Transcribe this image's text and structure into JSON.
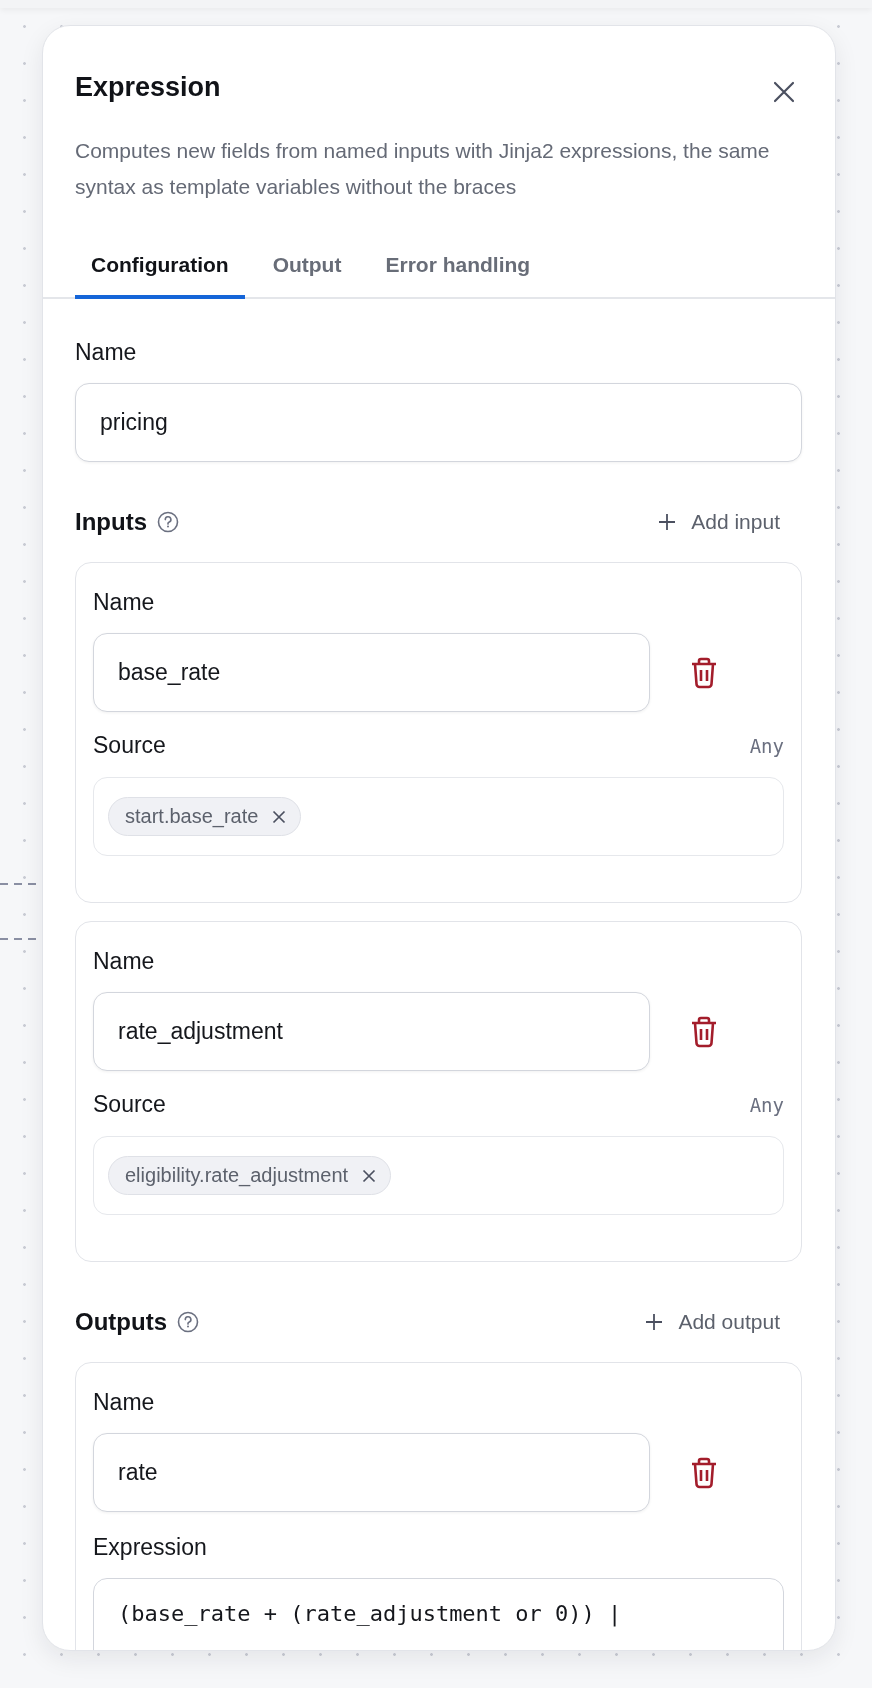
{
  "panel": {
    "title": "Expression",
    "description": "Computes new fields from named inputs with Jinja2 expressions, the same syntax as template variables without the braces"
  },
  "tabs": [
    {
      "label": "Configuration",
      "selected": true
    },
    {
      "label": "Output",
      "selected": false
    },
    {
      "label": "Error handling",
      "selected": false
    }
  ],
  "name_field": {
    "label": "Name",
    "value": "pricing"
  },
  "inputs": {
    "heading": "Inputs",
    "add_label": "Add input",
    "items": [
      {
        "name_label": "Name",
        "name": "base_rate",
        "source_label": "Source",
        "source_type": "Any",
        "tags": [
          "start.base_rate"
        ]
      },
      {
        "name_label": "Name",
        "name": "rate_adjustment",
        "source_label": "Source",
        "source_type": "Any",
        "tags": [
          "eligibility.rate_adjustment"
        ]
      }
    ]
  },
  "outputs": {
    "heading": "Outputs",
    "add_label": "Add output",
    "items": [
      {
        "name_label": "Name",
        "name": "rate",
        "expression_label": "Expression",
        "expression": "(base_rate + (rate_adjustment or 0)) |"
      }
    ]
  }
}
